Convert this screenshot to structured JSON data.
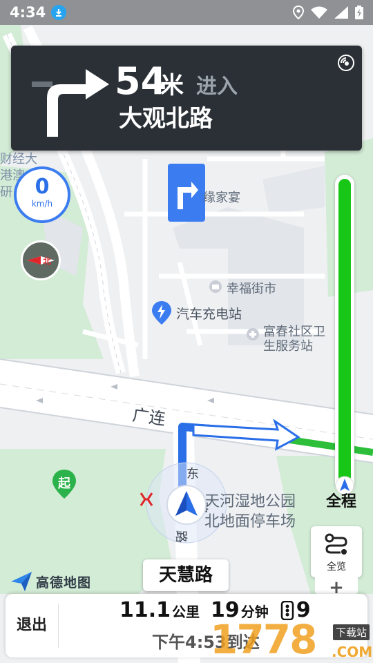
{
  "status_bar": {
    "time": "4:34",
    "icons": [
      "download-icon",
      "location-icon",
      "wifi-icon",
      "signal-icon",
      "battery-icon"
    ]
  },
  "guidance": {
    "distance": "54",
    "unit": "米",
    "action": "进入",
    "road": "大观北路",
    "turn": "turn-right-icon"
  },
  "speed": {
    "value": "0",
    "unit": "km/h"
  },
  "map_labels": {
    "poi_1": "缘家宴",
    "poi_2": "幸福街市",
    "poi_3": "汽车充电站",
    "poi_4_line1": "富春社区卫",
    "poi_4_line2": "生服务站",
    "poi_5_line1": "天河湿地公园",
    "poi_5_line2": "北地面停车场",
    "road_1": "广连",
    "road_2": "东",
    "road_3": "路",
    "road_4": "路",
    "start_marker": "起",
    "left_partial_1": "财经大",
    "left_partial_2": "港澳大",
    "left_partial_3": "研 究院"
  },
  "progress": {
    "label": "全程",
    "fraction": 0.0
  },
  "overview_button": {
    "label": "全览"
  },
  "zoom": {
    "label": "+"
  },
  "current_road": "天慧路",
  "logo": "高德地图",
  "bottom_panel": {
    "exit_label": "退出",
    "distance_value": "11.1",
    "distance_unit": "公里",
    "time_value": "19",
    "time_unit": "分钟",
    "traffic_lights": "9",
    "eta": "下午4:53到达"
  },
  "watermark": {
    "text": "1778",
    "badge": "下载站",
    "suffix": ".COM"
  },
  "colors": {
    "panel_bg": "#2b3036",
    "route_blue": "#2a6fe8",
    "progress_green": "#17c617",
    "map_bg": "#eef0f2",
    "park_green": "#d3ecd6"
  }
}
